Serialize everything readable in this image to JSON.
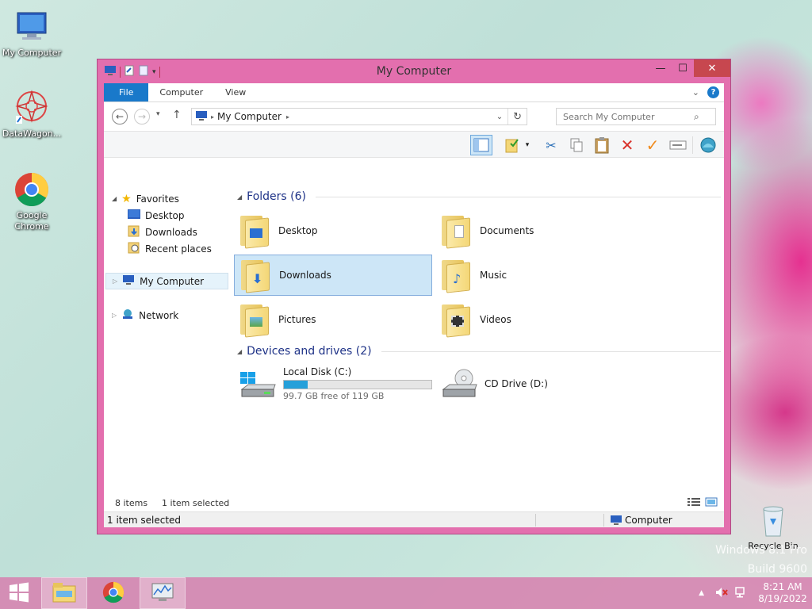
{
  "desktop": {
    "icons": [
      {
        "label": "My Computer",
        "icon": "computer-icon"
      },
      {
        "label": "DataWagon...",
        "icon": "datawagon-icon"
      },
      {
        "label": "Google Chrome",
        "icon": "chrome-icon"
      },
      {
        "label": "Recycle Bin",
        "icon": "recycle-bin-icon"
      }
    ],
    "watermark_line1": "Windows 8.1 Pro",
    "watermark_line2": "Build 9600"
  },
  "window": {
    "title": "My Computer",
    "ribbon_tabs": [
      "File",
      "Computer",
      "View"
    ],
    "address": {
      "crumb": "My Computer"
    },
    "search": {
      "placeholder": "Search My Computer"
    },
    "nav": {
      "favorites": "Favorites",
      "favorites_items": [
        "Desktop",
        "Downloads",
        "Recent places"
      ],
      "my_computer": "My Computer",
      "network": "Network"
    },
    "groups": {
      "folders_header": "Folders (6)",
      "drives_header": "Devices and drives (2)"
    },
    "folders": [
      {
        "label": "Desktop"
      },
      {
        "label": "Documents"
      },
      {
        "label": "Downloads",
        "selected": true
      },
      {
        "label": "Music"
      },
      {
        "label": "Pictures"
      },
      {
        "label": "Videos"
      }
    ],
    "drives": [
      {
        "label": "Local Disk (C:)",
        "free_text": "99.7 GB free of 119 GB",
        "used_fraction": 0.162
      },
      {
        "label": "CD Drive (D:)"
      }
    ],
    "status": {
      "items": "8 items",
      "selected": "1 item selected",
      "bottom_left": "1 item selected",
      "bottom_right": "Computer"
    }
  },
  "taskbar": {
    "time": "8:21 AM",
    "date": "8/19/2022"
  },
  "colors": {
    "window_border": "#e36fae",
    "accent": "#1979ca",
    "selection": "#cde6f7",
    "close_button": "#c7474f"
  }
}
